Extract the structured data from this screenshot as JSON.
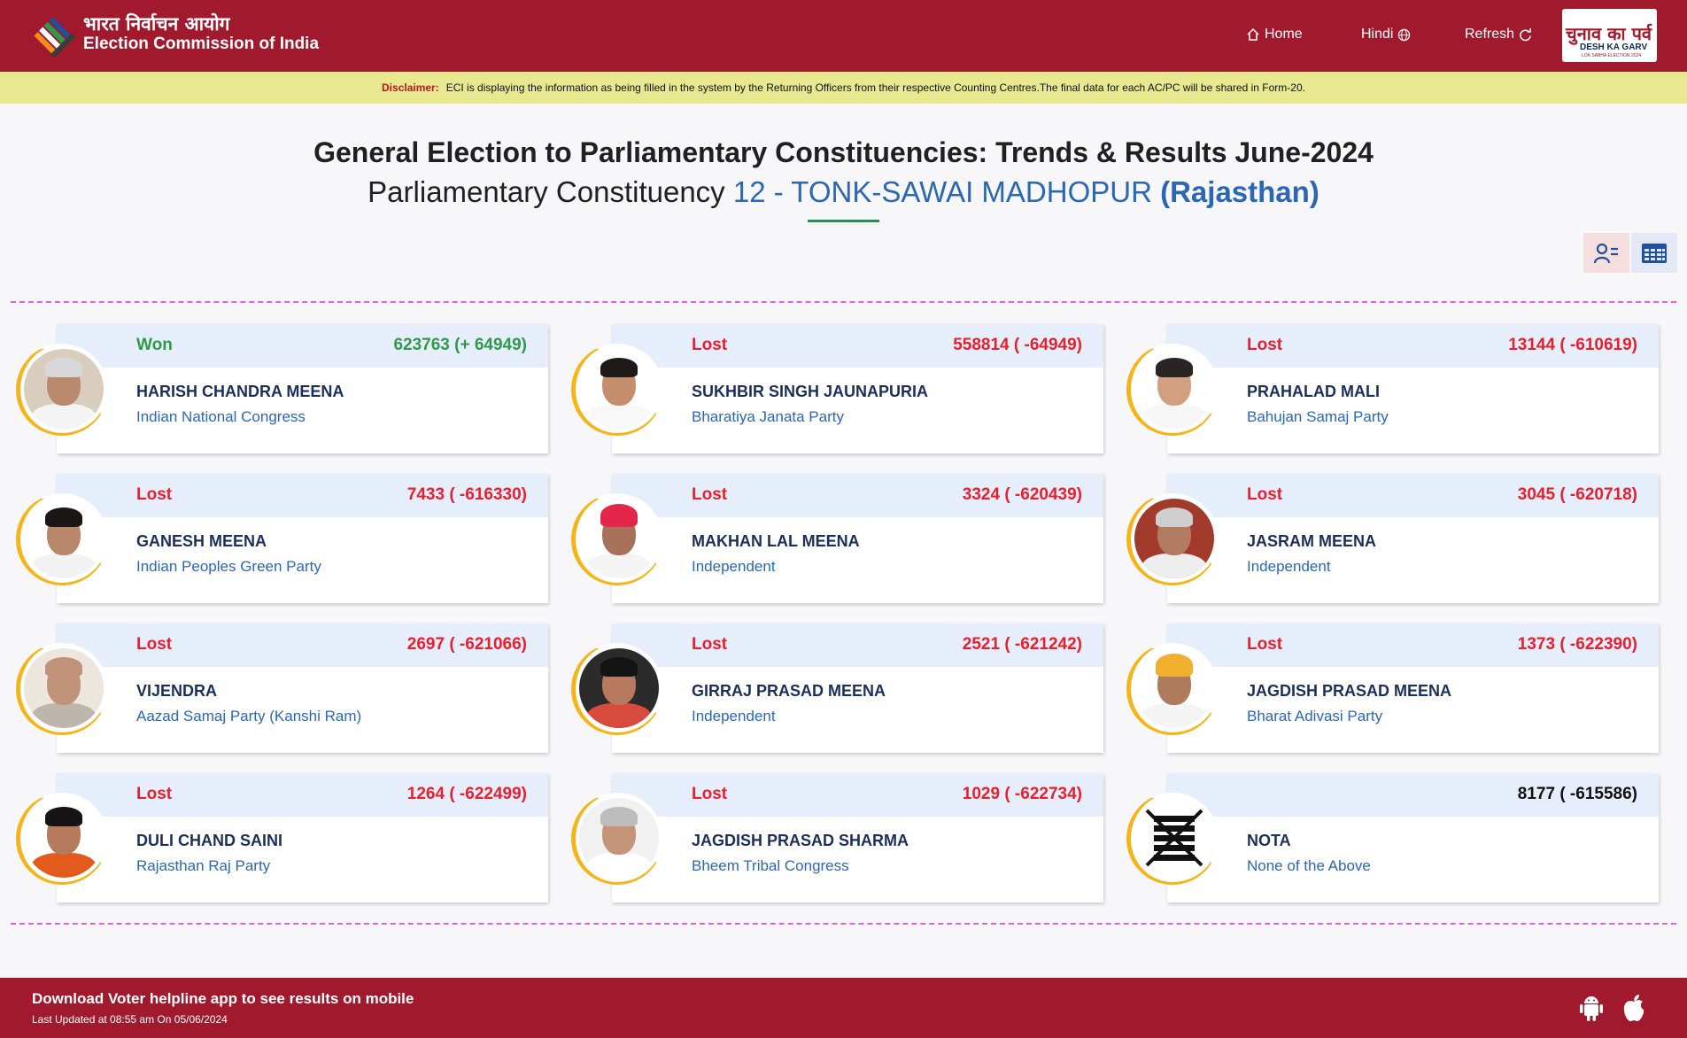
{
  "header": {
    "brand_hindi": "भारत निर्वाचन आयोग",
    "brand_english": "Election Commission of India",
    "nav": {
      "home": "Home",
      "hindi": "Hindi",
      "refresh": "Refresh"
    },
    "campaign": {
      "hindi": "चुनाव का पर्व",
      "english": "DESH KA GARV",
      "sub": "LOK SABHA ELECTION 2024"
    }
  },
  "disclaimer": {
    "label": "Disclaimer:",
    "text": "ECI is displaying the information as being filled in the system by the Returning Officers from their respective Counting Centres.The final data for each AC/PC will be shared in Form-20."
  },
  "title": {
    "line1": "General Election to Parliamentary Constituencies: Trends & Results June-2024",
    "prefix": "Parliamentary Constituency",
    "constituency": "12 - TONK-SAWAI MADHOPUR",
    "state": "(Rajasthan)"
  },
  "candidates": [
    {
      "status": "Won",
      "votes": "623763 (+ 64949)",
      "name": "HARISH CHANDRA MEENA",
      "party": "Indian National Congress"
    },
    {
      "status": "Lost",
      "votes": "558814 ( -64949)",
      "name": "SUKHBIR SINGH JAUNAPURIA",
      "party": "Bharatiya Janata Party"
    },
    {
      "status": "Lost",
      "votes": "13144 ( -610619)",
      "name": "PRAHALAD MALI",
      "party": "Bahujan Samaj Party"
    },
    {
      "status": "Lost",
      "votes": "7433 ( -616330)",
      "name": "GANESH MEENA",
      "party": "Indian Peoples Green Party"
    },
    {
      "status": "Lost",
      "votes": "3324 ( -620439)",
      "name": "MAKHAN LAL MEENA",
      "party": "Independent"
    },
    {
      "status": "Lost",
      "votes": "3045 ( -620718)",
      "name": "JASRAM MEENA",
      "party": "Independent"
    },
    {
      "status": "Lost",
      "votes": "2697 ( -621066)",
      "name": "VIJENDRA",
      "party": "Aazad Samaj Party (Kanshi Ram)"
    },
    {
      "status": "Lost",
      "votes": "2521 ( -621242)",
      "name": "GIRRAJ PRASAD MEENA",
      "party": "Independent"
    },
    {
      "status": "Lost",
      "votes": "1373 ( -622390)",
      "name": "JAGDISH PRASAD MEENA",
      "party": "Bharat Adivasi Party"
    },
    {
      "status": "Lost",
      "votes": "1264 ( -622499)",
      "name": "DULI CHAND SAINI",
      "party": "Rajasthan Raj Party"
    },
    {
      "status": "Lost",
      "votes": "1029 ( -622734)",
      "name": "JAGDISH PRASAD SHARMA",
      "party": "Bheem Tribal Congress"
    },
    {
      "status": "",
      "votes": "8177 ( -615586)",
      "name": "NOTA",
      "party": "None of the Above"
    }
  ],
  "footer": {
    "line1": "Download Voter helpline app to see results on mobile",
    "line2": "Last Updated at 08:55 am On 05/06/2024"
  },
  "colors": {
    "maroon": "#a0192c",
    "won": "#2e9a4a",
    "lost": "#e8202e",
    "blue": "#2b67b6",
    "disclaimer_bg": "#e7e88f"
  }
}
